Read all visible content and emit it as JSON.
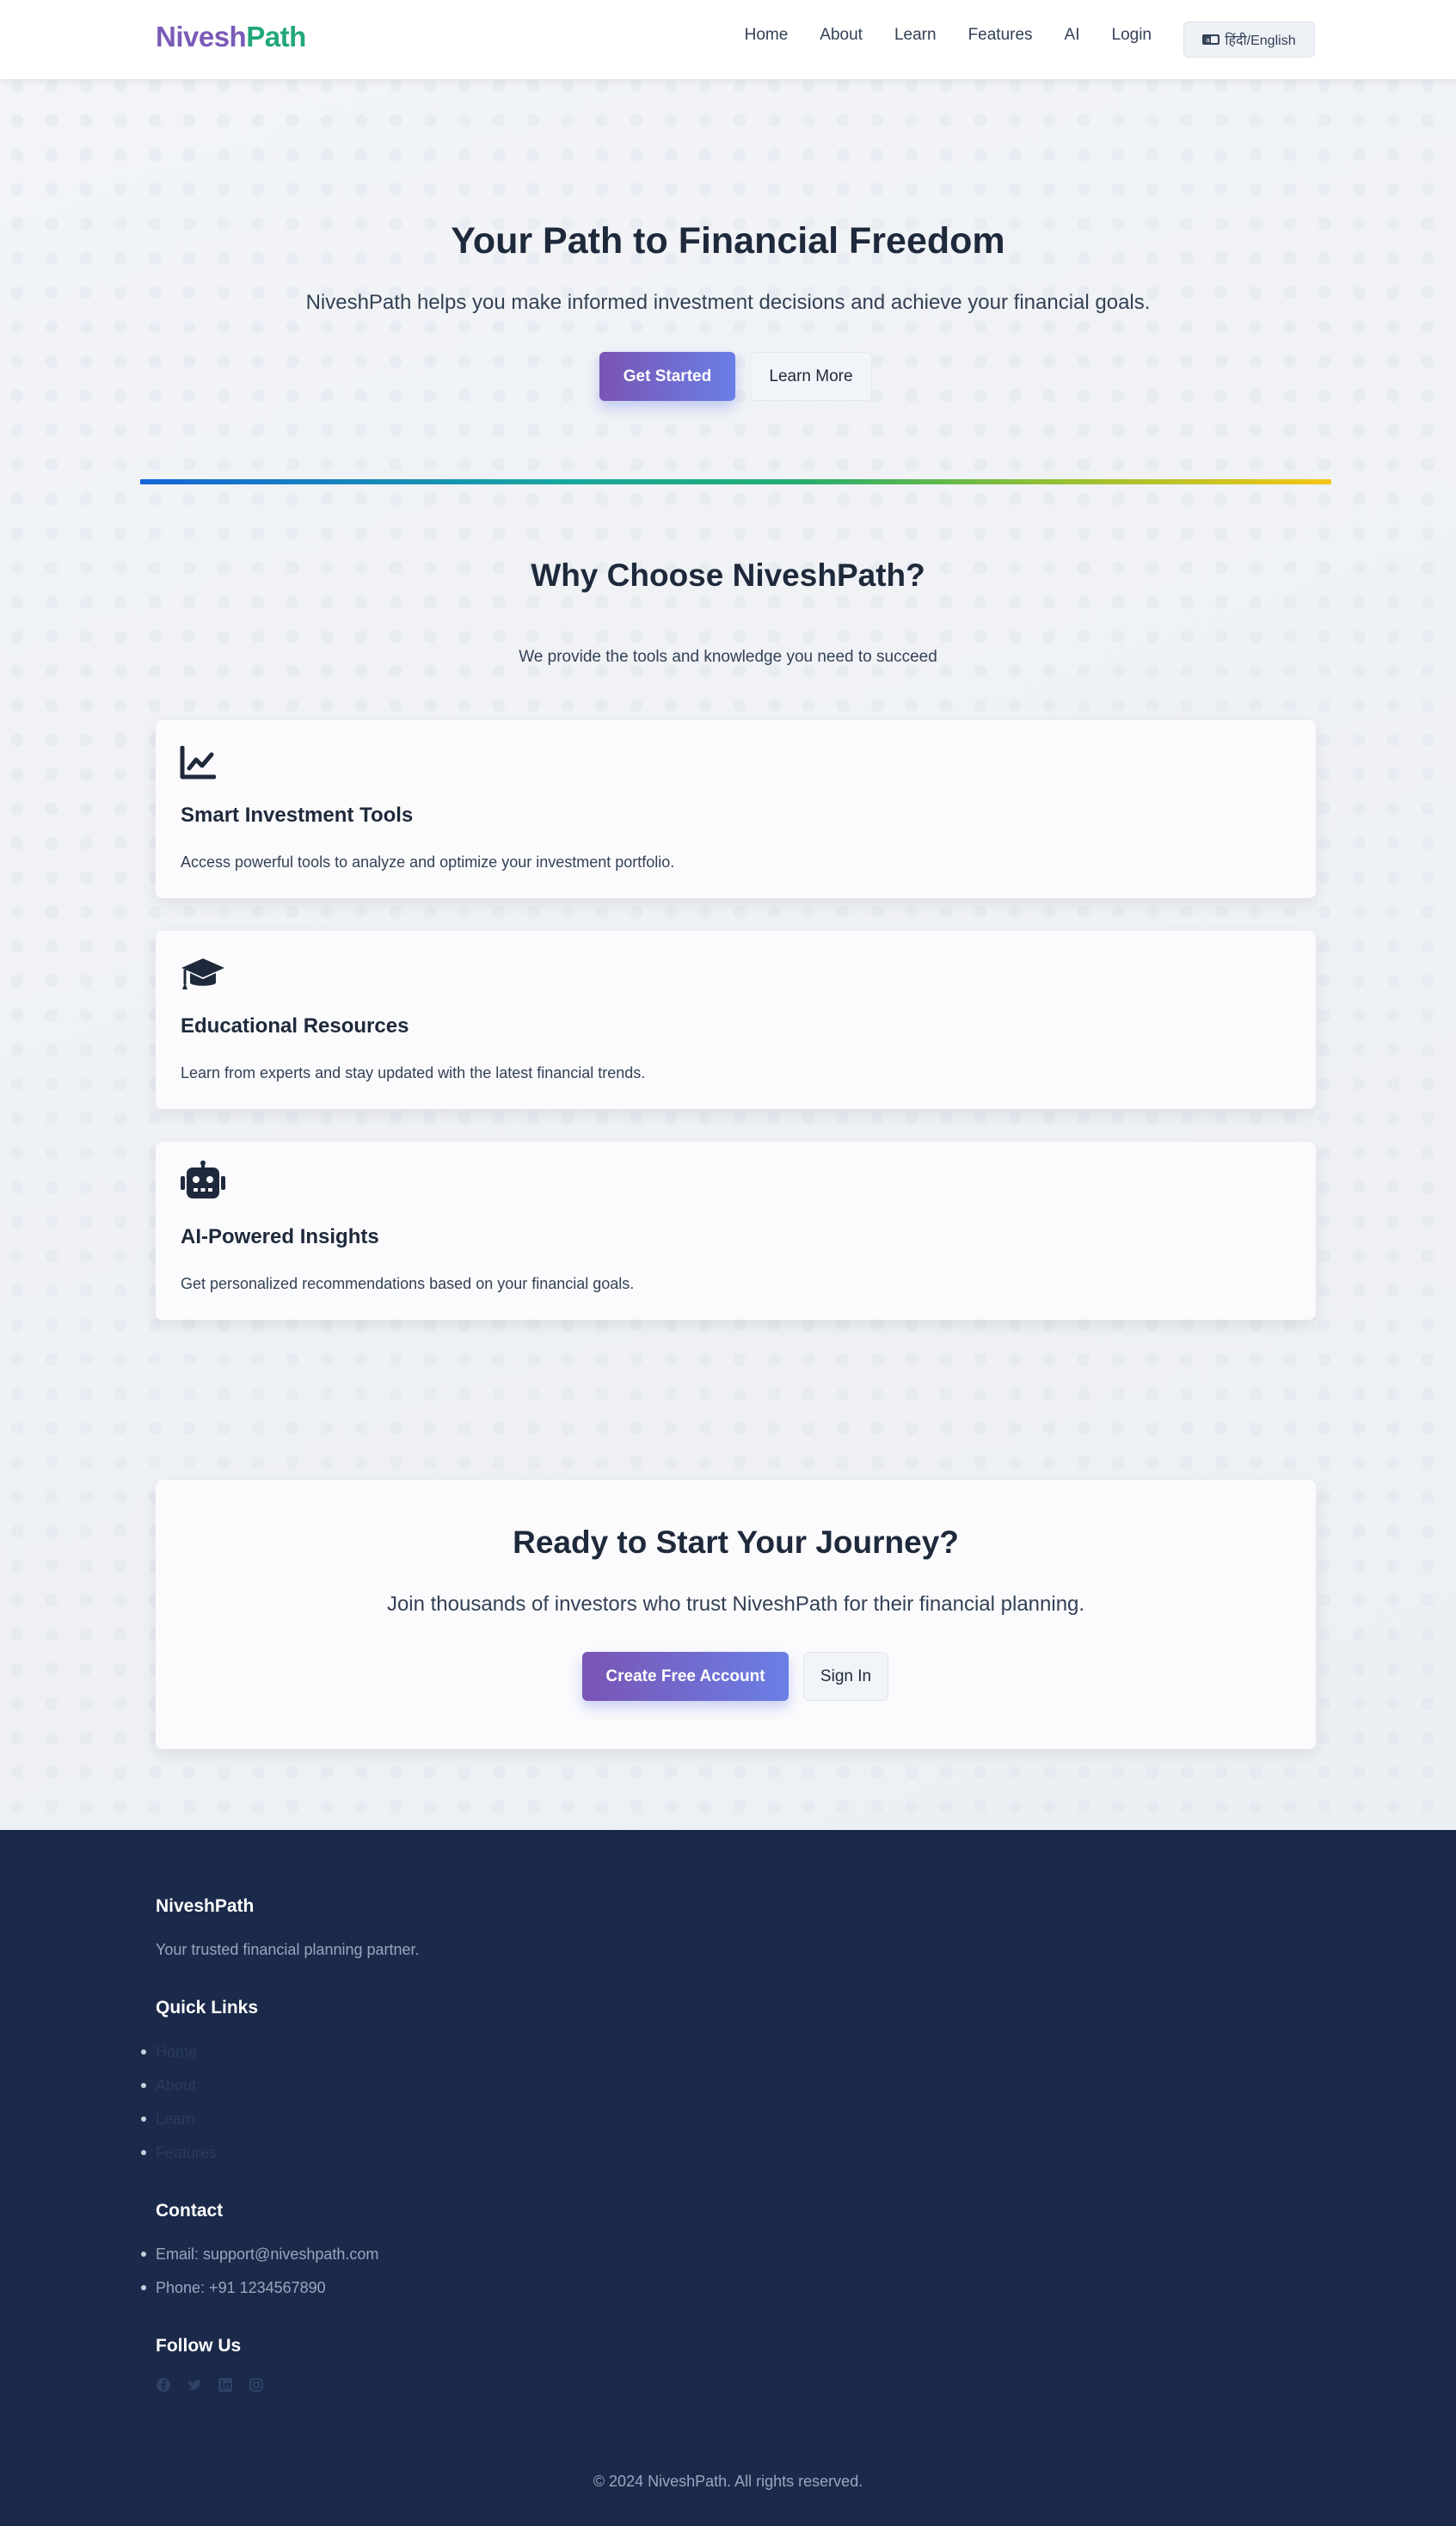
{
  "nav": {
    "logo_part1": "Nivesh",
    "logo_part2": "Path",
    "links": [
      "Home",
      "About",
      "Learn",
      "Features",
      "AI",
      "Login"
    ],
    "language_toggle": "हिंदी/English"
  },
  "hero": {
    "title": "Your Path to Financial Freedom",
    "subtitle": "NiveshPath helps you make informed investment decisions and achieve your financial goals.",
    "primary_button": "Get Started",
    "secondary_button": "Learn More"
  },
  "why": {
    "title": "Why Choose NiveshPath?",
    "subtitle": "We provide the tools and knowledge you need to succeed",
    "cards": [
      {
        "icon": "chart-line-icon",
        "title": "Smart Investment Tools",
        "description": "Access powerful tools to analyze and optimize your investment portfolio."
      },
      {
        "icon": "graduation-cap-icon",
        "title": "Educational Resources",
        "description": "Learn from experts and stay updated with the latest financial trends."
      },
      {
        "icon": "robot-icon",
        "title": "AI-Powered Insights",
        "description": "Get personalized recommendations based on your financial goals."
      }
    ]
  },
  "cta": {
    "title": "Ready to Start Your Journey?",
    "subtitle": "Join thousands of investors who trust NiveshPath for their financial planning.",
    "primary_button": "Create Free Account",
    "secondary_button": "Sign In"
  },
  "footer": {
    "brand_title": "NiveshPath",
    "brand_tagline": "Your trusted financial planning partner.",
    "quick_links_title": "Quick Links",
    "quick_links": [
      "Home",
      "About",
      "Learn",
      "Features"
    ],
    "contact_title": "Contact",
    "contact": [
      "Email: support@niveshpath.com",
      "Phone: +91 1234567890"
    ],
    "follow_title": "Follow Us",
    "social_icons": [
      "facebook-icon",
      "twitter-icon",
      "linkedin-icon",
      "instagram-icon"
    ],
    "copyright": "© 2024 NiveshPath. All rights reserved."
  },
  "colors": {
    "brand_purple": "#7b5bb8",
    "brand_green": "#22a77a",
    "button_gradient_start": "#7a54b4",
    "button_gradient_end": "#6a7fe6",
    "footer_bg": "#1b2a4a"
  }
}
